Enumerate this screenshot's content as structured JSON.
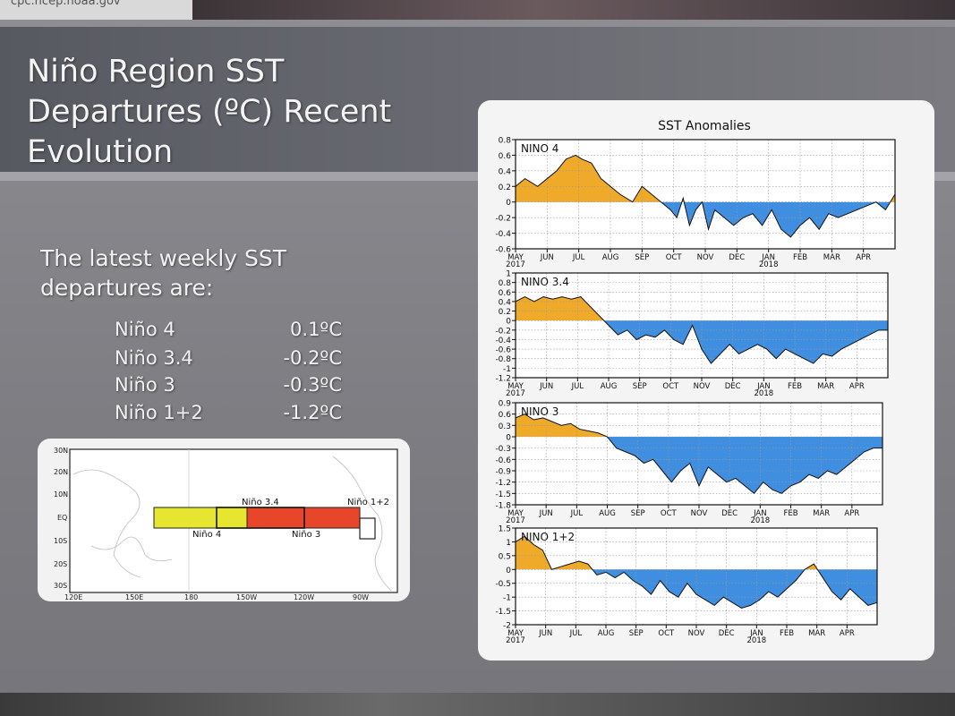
{
  "browser": {
    "url": "cpc.ncep.noaa.gov"
  },
  "slide": {
    "title": "Niño Region SST Departures (ºC) Recent Evolution",
    "latest_heading": "The latest weekly SST departures are:",
    "readings": [
      {
        "region": "Niño 4",
        "value": "0.1ºC"
      },
      {
        "region": "Niño 3.4",
        "value": "-0.2ºC"
      },
      {
        "region": "Niño 3",
        "value": "-0.3ºC"
      },
      {
        "region": "Niño 1+2",
        "value": "-1.2ºC"
      }
    ]
  },
  "map": {
    "lat_labels": [
      "30N",
      "20N",
      "10N",
      "EQ",
      "10S",
      "20S",
      "30S"
    ],
    "lon_labels": [
      "120E",
      "150E",
      "180",
      "150W",
      "120W",
      "90W"
    ],
    "region_labels": {
      "nino4": "Niño 4",
      "nino34": "Niño 3.4",
      "nino3": "Niño 3",
      "nino12": "Niño 1+2"
    },
    "colors": {
      "nino4": "#e6e631",
      "nino3": "#e8462a",
      "nino12": "#ffffff"
    }
  },
  "chart_data": {
    "type": "area",
    "title": "SST Anomalies",
    "month_labels": [
      "MAY",
      "JUN",
      "JUL",
      "AUG",
      "SEP",
      "OCT",
      "NOV",
      "DEC",
      "JAN",
      "FEB",
      "MAR",
      "APR"
    ],
    "year_labels": [
      "2017",
      "2018"
    ],
    "x_range": [
      "2017-05-01",
      "2018-04-30"
    ],
    "colors": {
      "positive": "#f0aa2a",
      "negative": "#3f8ee0"
    },
    "panels": [
      {
        "name": "NINO 4",
        "ylim": [
          -0.6,
          0.8
        ],
        "ticks": [
          "0.8",
          "0.6",
          "0.4",
          "0.2",
          "0",
          "-0.2",
          "-0.4",
          "-0.6"
        ],
        "x": [
          0,
          0.3,
          0.7,
          1,
          1.3,
          1.6,
          1.9,
          2.1,
          2.4,
          2.7,
          3,
          3.3,
          3.7,
          4,
          4.3,
          4.6,
          4.9,
          5.1,
          5.3,
          5.5,
          5.7,
          5.9,
          6.1,
          6.3,
          6.6,
          6.9,
          7.2,
          7.5,
          7.8,
          8.1,
          8.4,
          8.7,
          9,
          9.3,
          9.6,
          9.9,
          10.2,
          10.5,
          10.8,
          11.1,
          11.4,
          11.7,
          12
        ],
        "y": [
          0.2,
          0.3,
          0.2,
          0.3,
          0.4,
          0.55,
          0.6,
          0.55,
          0.5,
          0.3,
          0.2,
          0.1,
          0.0,
          0.2,
          0.1,
          0.0,
          -0.1,
          -0.2,
          0.05,
          -0.3,
          -0.1,
          0.0,
          -0.35,
          -0.1,
          -0.2,
          -0.3,
          -0.2,
          -0.15,
          -0.3,
          -0.1,
          -0.35,
          -0.45,
          -0.3,
          -0.2,
          -0.35,
          -0.15,
          -0.2,
          -0.15,
          -0.1,
          -0.05,
          0.0,
          -0.1,
          0.1
        ]
      },
      {
        "name": "NINO 3.4",
        "ylim": [
          -1.2,
          1
        ],
        "ticks": [
          "1",
          "0.8",
          "0.6",
          "0.4",
          "0.2",
          "0",
          "-0.2",
          "-0.4",
          "-0.6",
          "-0.8",
          "-1",
          "-1.2"
        ],
        "x": [
          0,
          0.3,
          0.6,
          0.9,
          1.2,
          1.5,
          1.8,
          2.1,
          2.4,
          2.7,
          3,
          3.3,
          3.6,
          3.9,
          4.2,
          4.5,
          4.8,
          5.1,
          5.4,
          5.7,
          6,
          6.3,
          6.6,
          6.9,
          7.2,
          7.5,
          7.8,
          8.1,
          8.4,
          8.7,
          9,
          9.3,
          9.6,
          9.9,
          10.2,
          10.5,
          10.8,
          11.1,
          11.4,
          11.7,
          12
        ],
        "y": [
          0.4,
          0.5,
          0.4,
          0.5,
          0.45,
          0.5,
          0.45,
          0.5,
          0.3,
          0.1,
          -0.1,
          -0.3,
          -0.2,
          -0.4,
          -0.3,
          -0.35,
          -0.2,
          -0.4,
          -0.5,
          -0.1,
          -0.6,
          -0.9,
          -0.7,
          -0.5,
          -0.7,
          -0.6,
          -0.5,
          -0.6,
          -0.8,
          -0.6,
          -0.7,
          -0.8,
          -0.9,
          -0.7,
          -0.75,
          -0.6,
          -0.5,
          -0.4,
          -0.3,
          -0.2,
          -0.2
        ]
      },
      {
        "name": "NINO 3",
        "ylim": [
          -1.8,
          0.9
        ],
        "ticks": [
          "0.9",
          "0.6",
          "0.3",
          "0",
          "-0.3",
          "-0.6",
          "-0.9",
          "-1.2",
          "-1.5",
          "-1.8"
        ],
        "x": [
          0,
          0.3,
          0.6,
          0.9,
          1.2,
          1.5,
          1.8,
          2.1,
          2.4,
          2.7,
          3,
          3.3,
          3.6,
          3.9,
          4.2,
          4.5,
          4.8,
          5.1,
          5.4,
          5.7,
          6,
          6.3,
          6.6,
          6.9,
          7.2,
          7.5,
          7.8,
          8.1,
          8.4,
          8.7,
          9,
          9.3,
          9.6,
          9.9,
          10.2,
          10.5,
          10.8,
          11.1,
          11.4,
          11.7,
          12
        ],
        "y": [
          0.5,
          0.6,
          0.45,
          0.5,
          0.4,
          0.3,
          0.35,
          0.2,
          0.15,
          0.1,
          0.0,
          -0.3,
          -0.4,
          -0.5,
          -0.7,
          -0.6,
          -0.9,
          -1.2,
          -0.9,
          -0.7,
          -1.3,
          -0.8,
          -1.0,
          -1.2,
          -1.1,
          -1.3,
          -1.5,
          -1.2,
          -1.4,
          -1.5,
          -1.3,
          -1.2,
          -1.0,
          -1.1,
          -0.9,
          -1.0,
          -0.8,
          -0.6,
          -0.4,
          -0.3,
          -0.3
        ]
      },
      {
        "name": "NINO 1+2",
        "ylim": [
          -2,
          1.5
        ],
        "ticks": [
          "1.5",
          "1",
          "0.5",
          "0",
          "-0.5",
          "-1",
          "-1.5",
          "-2"
        ],
        "x": [
          0,
          0.3,
          0.6,
          0.9,
          1.2,
          1.5,
          1.8,
          2.1,
          2.4,
          2.7,
          3,
          3.3,
          3.6,
          3.9,
          4.2,
          4.5,
          4.8,
          5.1,
          5.4,
          5.7,
          6,
          6.3,
          6.6,
          6.9,
          7.2,
          7.5,
          7.8,
          8.1,
          8.4,
          8.7,
          9,
          9.3,
          9.6,
          9.9,
          10.2,
          10.5,
          10.8,
          11.1,
          11.4,
          11.7,
          12
        ],
        "y": [
          1.0,
          1.2,
          0.9,
          0.7,
          0.0,
          0.1,
          0.2,
          0.3,
          0.2,
          -0.2,
          -0.1,
          -0.3,
          -0.1,
          -0.4,
          -0.6,
          -0.9,
          -0.4,
          -0.8,
          -1.0,
          -0.5,
          -0.9,
          -1.1,
          -1.3,
          -1.0,
          -1.2,
          -1.4,
          -1.3,
          -1.1,
          -0.8,
          -1.0,
          -0.7,
          -0.4,
          0.0,
          0.2,
          -0.3,
          -0.8,
          -1.1,
          -0.7,
          -1.0,
          -1.3,
          -1.2
        ]
      }
    ]
  }
}
